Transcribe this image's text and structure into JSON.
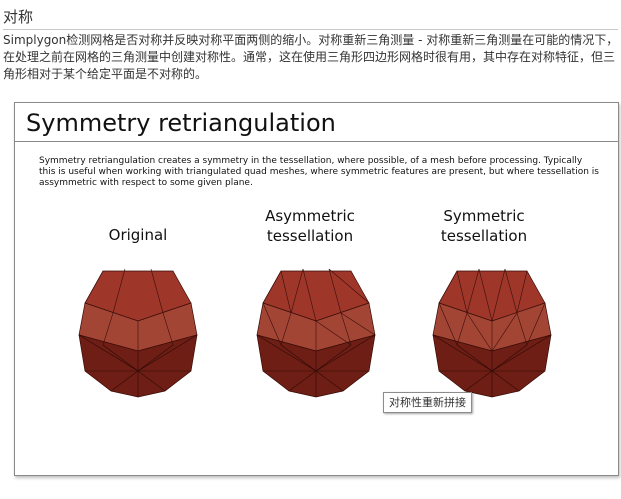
{
  "section": {
    "title": "对称",
    "description": "Simplygon检测网格是否对称并反映对称平面两侧的缩小。对称重新三角测量 - 对称重新三角测量在可能的情况下，在处理之前在网格的三角测量中创建对称性。通常，这在使用三角形四边形网格时很有用，其中存在对称特征，但三角形相对于某个给定平面是不对称的。"
  },
  "figure": {
    "title": "Symmetry retriangulation",
    "caption": "Symmetry retriangulation creates a symmetry in the tessellation, where possible, of a mesh before processing. Typically this is useful when working with triangulated quad meshes, where symmetric features are present, but where tessellation is assymmetric with respect to some given plane.",
    "labels": {
      "original": "Original",
      "asymmetric_line1": "Asymmetric",
      "asymmetric_line2": "tessellation",
      "symmetric_line1": "Symmetric",
      "symmetric_line2": "tessellation"
    }
  },
  "tooltip": {
    "text": "对称性重新拼接"
  },
  "colors": {
    "mesh_top": "#a83a2c",
    "mesh_side": "#7a2418",
    "mesh_dark": "#5c170f",
    "edge": "#3a0d08"
  }
}
